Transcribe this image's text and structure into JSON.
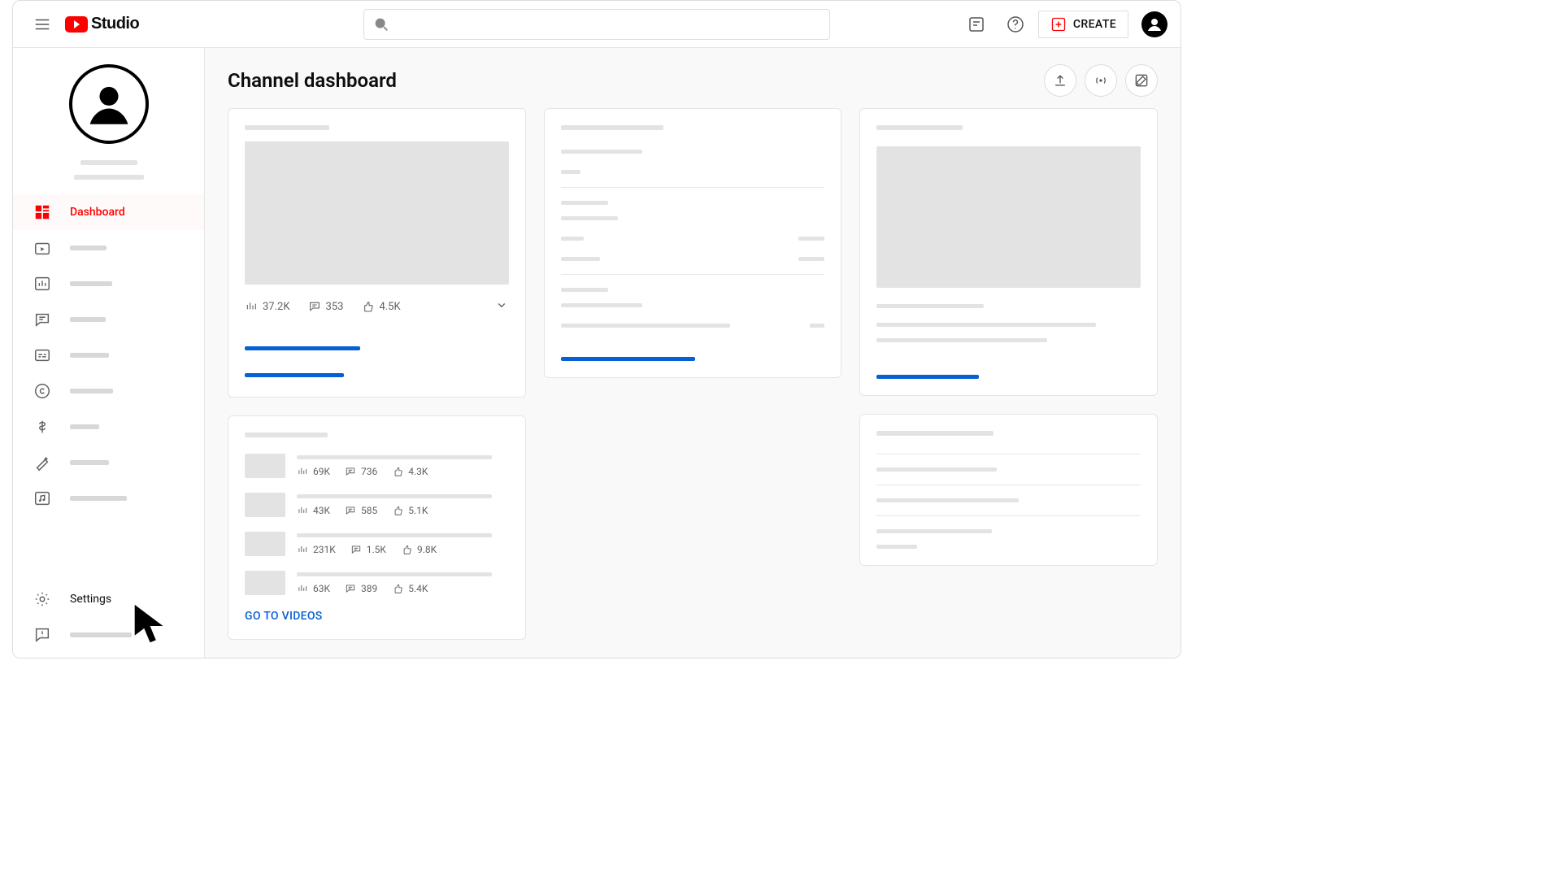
{
  "header": {
    "logo_text": "Studio",
    "search_placeholder": "",
    "create_label": "CREATE"
  },
  "sidebar": {
    "items": [
      {
        "icon": "dashboard",
        "label": "Dashboard",
        "active": true
      },
      {
        "icon": "content",
        "skel_w": 45
      },
      {
        "icon": "analytics",
        "skel_w": 52
      },
      {
        "icon": "comments",
        "skel_w": 44
      },
      {
        "icon": "subtitles",
        "skel_w": 48
      },
      {
        "icon": "copyright",
        "skel_w": 53
      },
      {
        "icon": "monetization",
        "skel_w": 36
      },
      {
        "icon": "customization",
        "skel_w": 48
      },
      {
        "icon": "audio",
        "skel_w": 70
      }
    ],
    "bottom": [
      {
        "icon": "settings",
        "label": "Settings"
      },
      {
        "icon": "feedback",
        "skel_w": 76
      }
    ]
  },
  "main": {
    "title": "Channel dashboard",
    "latest_video": {
      "views": "37.2K",
      "comments": "353",
      "likes": "4.5K"
    },
    "recent_videos": [
      {
        "views": "69K",
        "comments": "736",
        "likes": "4.3K"
      },
      {
        "views": "43K",
        "comments": "585",
        "likes": "5.1K"
      },
      {
        "views": "231K",
        "comments": "1.5K",
        "likes": "9.8K"
      },
      {
        "views": "63K",
        "comments": "389",
        "likes": "5.4K"
      }
    ],
    "go_to_videos": "GO TO VIDEOS"
  }
}
